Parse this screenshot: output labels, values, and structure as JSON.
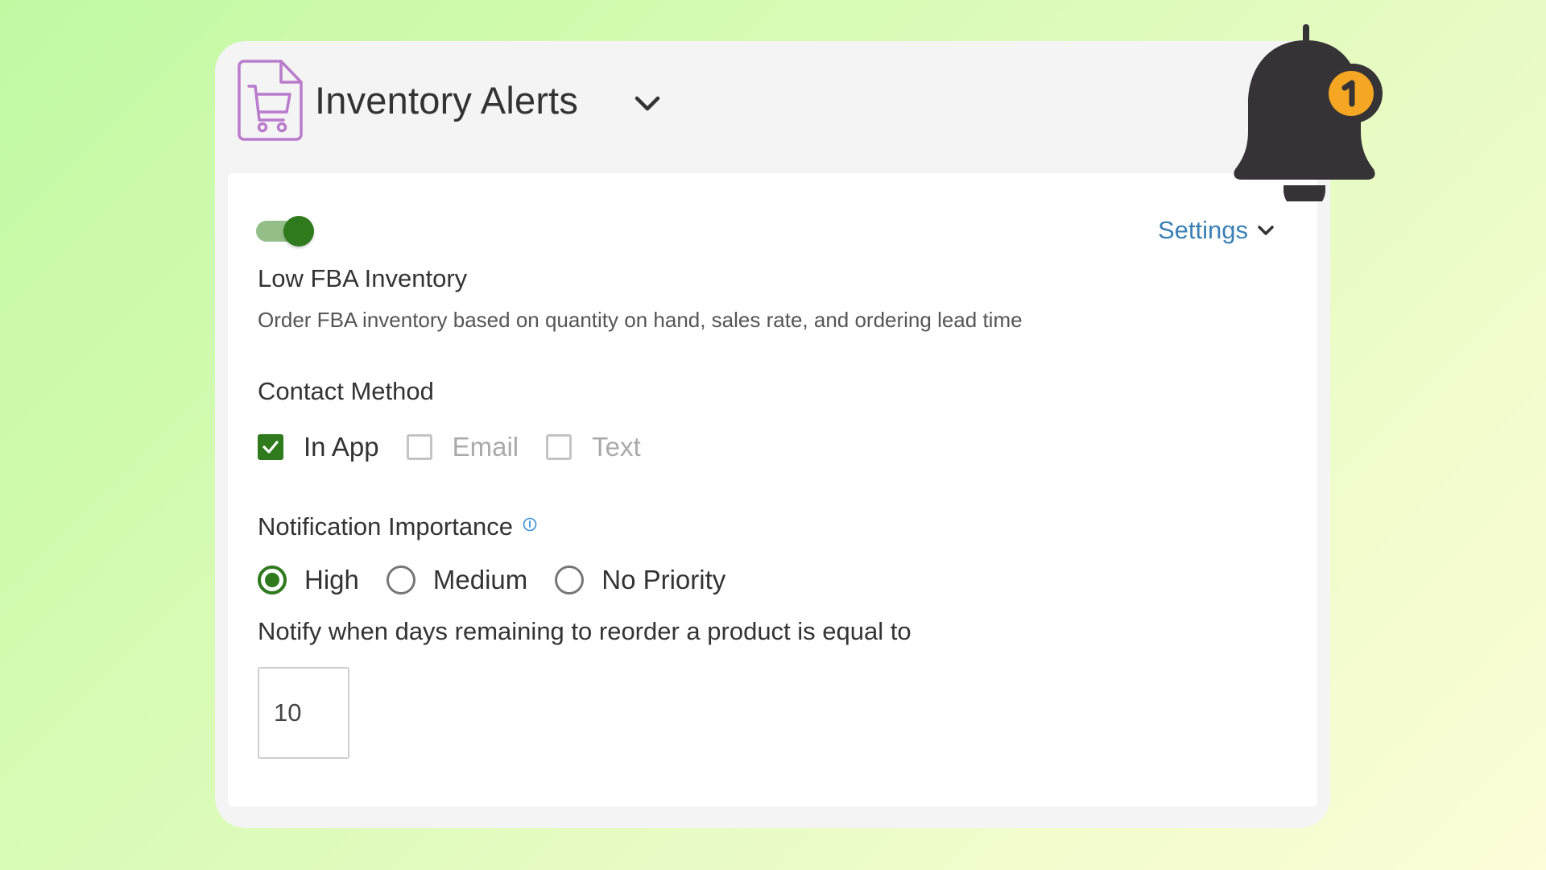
{
  "header": {
    "title": "Inventory Alerts",
    "icon": "cart-document-icon",
    "icon_color": "#b97ccc",
    "expand_icon": "chevron-down-icon"
  },
  "notification_bell": {
    "icon": "bell-icon",
    "badge_count": "1",
    "badge_color": "#f5a623"
  },
  "alert": {
    "enabled": true,
    "title": "Low FBA Inventory",
    "description": "Order FBA inventory based on quantity on hand, sales rate, and ordering lead time",
    "settings_label": "Settings"
  },
  "contact_method": {
    "label": "Contact Method",
    "options": [
      {
        "label": "In App",
        "checked": true
      },
      {
        "label": "Email",
        "checked": false
      },
      {
        "label": "Text",
        "checked": false
      }
    ]
  },
  "importance": {
    "label": "Notification Importance",
    "info_icon": "info-icon",
    "options": [
      {
        "label": "High",
        "selected": true
      },
      {
        "label": "Medium",
        "selected": false
      },
      {
        "label": "No Priority",
        "selected": false
      }
    ]
  },
  "reorder": {
    "label": "Notify when days remaining to reorder a product is equal to",
    "value": "10"
  },
  "colors": {
    "accent_green": "#2e7a1d",
    "link_blue": "#3b80b5",
    "bell_dark": "#353336"
  }
}
